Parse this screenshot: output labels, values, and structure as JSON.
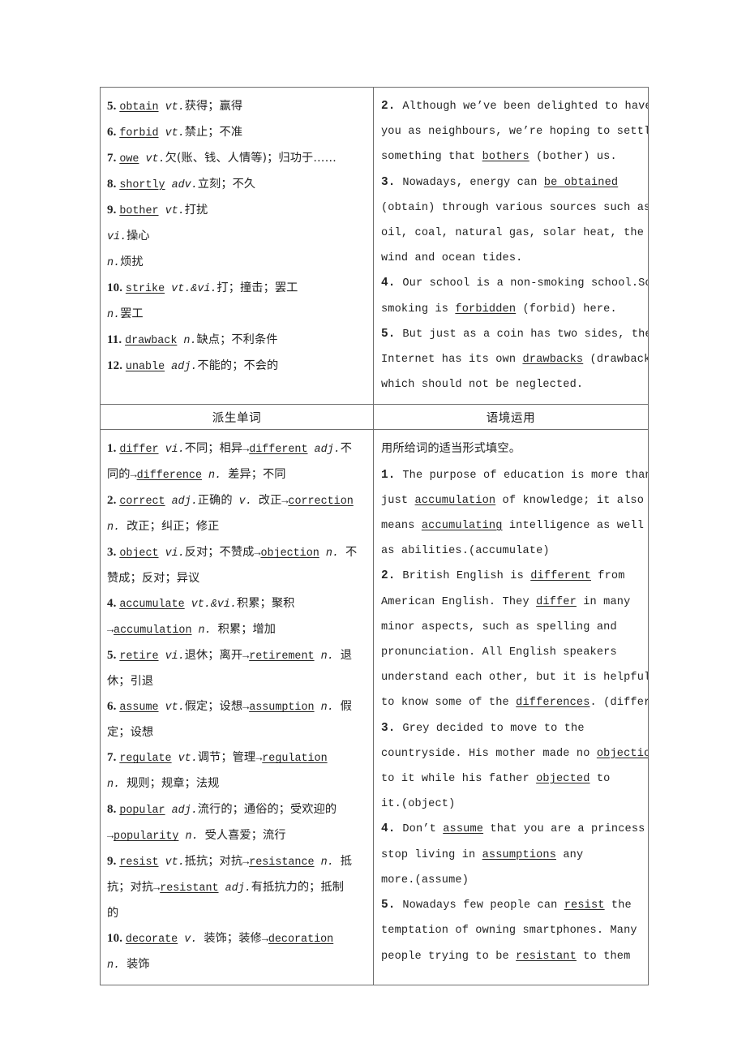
{
  "page": {
    "type": "textbook-vocabulary-table",
    "language_mix": "english-chinese"
  },
  "table": {
    "top_row": {
      "left_cell": {
        "name": "core-words-continued",
        "entries": [
          {
            "num": "5.",
            "word": "obtain",
            "pos": "vt.",
            "cn": "获得；赢得"
          },
          {
            "num": "6.",
            "word": "forbid",
            "pos": "vt.",
            "cn": "禁止；不准"
          },
          {
            "num": "7.",
            "word": "owe",
            "pos": "vt.",
            "cn": "欠(账、钱、人情等)；归功于……"
          },
          {
            "num": "8.",
            "word": "shortly",
            "pos": "adv.",
            "cn": "立刻；不久"
          },
          {
            "num": "9.",
            "word": "bother",
            "pos": "vt.",
            "cn": "打扰"
          },
          {
            "num": "",
            "word": "",
            "pos": "vi.",
            "cn": "操心"
          },
          {
            "num": "",
            "word": "",
            "pos": "n.",
            "cn": "烦扰"
          },
          {
            "num": "10.",
            "word": "strike",
            "pos": "vt.&vi.",
            "cn": "打；撞击；罢工"
          },
          {
            "num": "",
            "word": "",
            "pos": "n.",
            "cn": "罢工"
          },
          {
            "num": "11.",
            "word": "drawback",
            "pos": "n.",
            "cn": "缺点；不利条件"
          },
          {
            "num": "12.",
            "word": "unable",
            "pos": "adj.",
            "cn": "不能的；不会的"
          }
        ]
      },
      "right_cell": {
        "name": "sentence-practice-continued",
        "items": [
          {
            "num": "2.",
            "lines": [
              "Although we’ve been delighted to have",
              "you as neighbours, we’re hoping to settle",
              "something that |bothers| (bother) us."
            ]
          },
          {
            "num": "3.",
            "lines": [
              "Nowadays, energy can |be obtained|",
              "(obtain) through various sources such as",
              "oil, coal, natural gas, solar heat, the",
              "wind and ocean tides."
            ]
          },
          {
            "num": "4.",
            "lines": [
              "Our school is a non-smoking school.So",
              "smoking is |forbidden| (forbid) here."
            ]
          },
          {
            "num": "5.",
            "lines": [
              "But just as a coin has two sides, the",
              "Internet has its own |drawbacks| (drawback)",
              "which should not be neglected."
            ]
          }
        ]
      }
    },
    "headers": {
      "left": "派生单词",
      "right": "语境运用"
    },
    "bottom_row": {
      "left_cell": {
        "name": "derived-words",
        "entries": [
          {
            "num": "1.",
            "lines": [
              "|differ| vi.|不同；相异|→|different| adj.|不",
              "|同的|→|difference| n. |差异；不同|"
            ]
          },
          {
            "num": "2.",
            "lines": [
              "|correct| adj.|正确的| v. |改正|→|correction|",
              "n. |改正；纠正；修正|"
            ]
          },
          {
            "num": "3.",
            "lines": [
              "|object| vi.|反对；不赞成|→|objection| n. |不",
              "|赞成；反对；异议|"
            ]
          },
          {
            "num": "4.",
            "lines": [
              "|accumulate| vt.&vi.|积累；聚积|",
              "→|accumulation| n. |积累；增加|"
            ]
          },
          {
            "num": "5.",
            "lines": [
              "|retire| vi.|退休；离开|→|retirement| n. |退",
              "|休；引退|"
            ]
          },
          {
            "num": "6.",
            "lines": [
              "|assume| vt.|假定；设想|→|assumption| n. |假",
              "|定；设想|"
            ]
          },
          {
            "num": "7.",
            "lines": [
              "|regulate| vt.|调节；管理|→|regulation|",
              "n. |规则；规章；法规|"
            ]
          },
          {
            "num": "8.",
            "lines": [
              "|popular| adj.|流行的；通俗的；受欢迎的|",
              "→|popularity| n. |受人喜爱；流行|"
            ]
          },
          {
            "num": "9.",
            "lines": [
              "|resist| vt.|抵抗；对抗|→|resistance| n. |抵",
              "|抗；对抗|→|resistant| adj.|有抵抗力的；抵制",
              "|的|"
            ]
          },
          {
            "num": "10.",
            "lines": [
              "|decorate| v. |装饰；装修|→|decoration|",
              "n. |装饰|"
            ]
          }
        ]
      },
      "right_cell": {
        "name": "context-usage",
        "instruction": "用所给词的适当形式填空。",
        "items": [
          {
            "num": "1.",
            "lines": [
              "The purpose of education is more than",
              "just |accumulation| of knowledge; it also",
              "means |accumulating| intelligence as well",
              "as abilities.(accumulate)"
            ]
          },
          {
            "num": "2.",
            "lines": [
              "British English is |different| from",
              "American English. They |differ| in many",
              "minor aspects, such as spelling and",
              "pronunciation. All English speakers",
              "understand each other, but it is helpful",
              "to know some of the |differences|. (differ)"
            ]
          },
          {
            "num": "3.",
            "lines": [
              "Grey decided to move to the",
              "countryside. His mother made no |objection|",
              "to it while his father |objected| to",
              "it.(object)"
            ]
          },
          {
            "num": "4.",
            "lines": [
              "Don’t |assume| that you are a princess a",
              "stop living in |assumptions| any",
              "more.(assume)"
            ]
          },
          {
            "num": "5.",
            "lines": [
              "Nowadays few people can |resist| the",
              "temptation of owning smartphones. Many",
              "people trying to be |resistant| to them"
            ]
          }
        ]
      }
    }
  }
}
